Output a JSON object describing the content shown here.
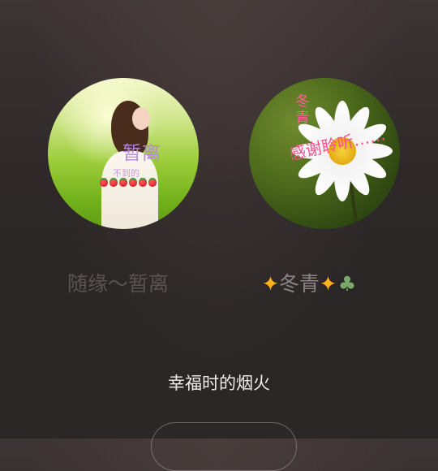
{
  "users": [
    {
      "name": "随缘～暂离",
      "avatar_overlay_name": "暂离",
      "avatar_overlay_sub": "不到的"
    },
    {
      "name_text": "冬青",
      "name_leading_icon": "sparkle-icon",
      "name_trailing_icons": [
        "sparkle-icon",
        "clover-icon"
      ],
      "avatar_overlay_title": "冬青",
      "avatar_overlay_caption": "感谢聆听……"
    }
  ],
  "song": {
    "title": "幸福时的烟火"
  },
  "colors": {
    "sparkle": "#ffb21e",
    "clover": "#7ba86a",
    "overlay_pink": "#ff4f8d",
    "overlay_purple": "#b58ad8"
  }
}
